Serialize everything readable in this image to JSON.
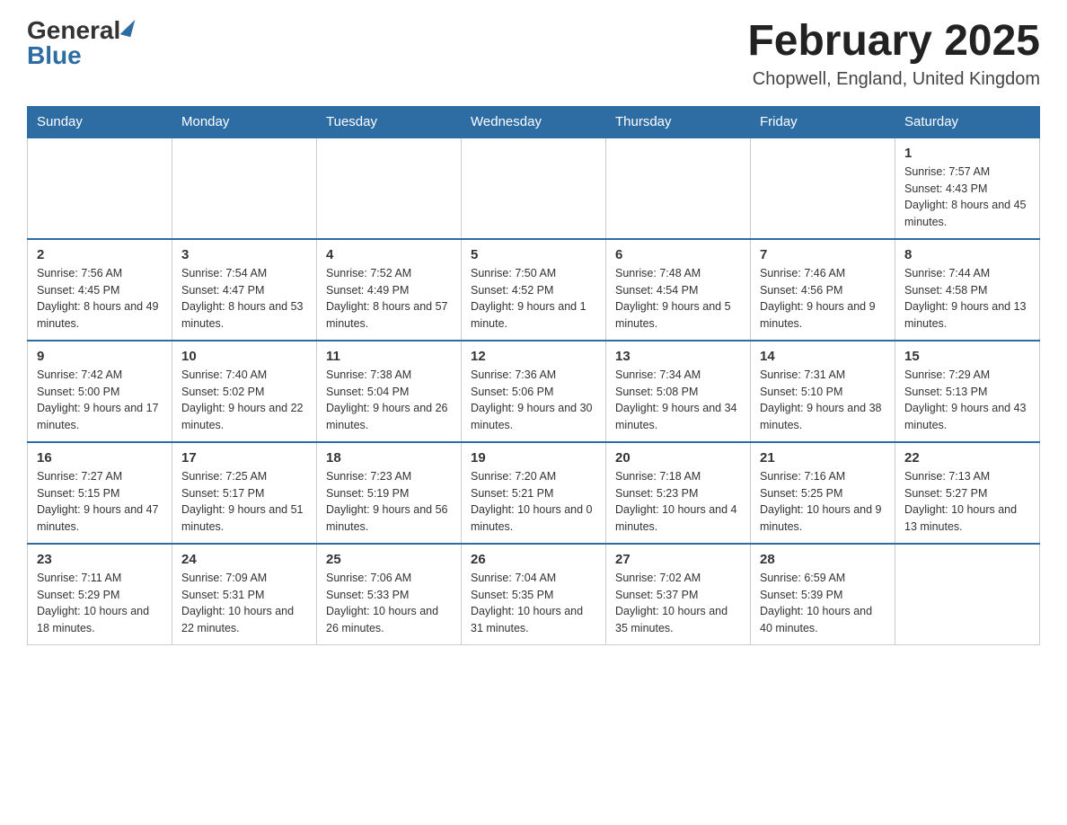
{
  "header": {
    "logo_general": "General",
    "logo_blue": "Blue",
    "month_title": "February 2025",
    "location": "Chopwell, England, United Kingdom"
  },
  "days_of_week": [
    "Sunday",
    "Monday",
    "Tuesday",
    "Wednesday",
    "Thursday",
    "Friday",
    "Saturday"
  ],
  "weeks": [
    [
      {
        "day": "",
        "info": ""
      },
      {
        "day": "",
        "info": ""
      },
      {
        "day": "",
        "info": ""
      },
      {
        "day": "",
        "info": ""
      },
      {
        "day": "",
        "info": ""
      },
      {
        "day": "",
        "info": ""
      },
      {
        "day": "1",
        "info": "Sunrise: 7:57 AM\nSunset: 4:43 PM\nDaylight: 8 hours and 45 minutes."
      }
    ],
    [
      {
        "day": "2",
        "info": "Sunrise: 7:56 AM\nSunset: 4:45 PM\nDaylight: 8 hours and 49 minutes."
      },
      {
        "day": "3",
        "info": "Sunrise: 7:54 AM\nSunset: 4:47 PM\nDaylight: 8 hours and 53 minutes."
      },
      {
        "day": "4",
        "info": "Sunrise: 7:52 AM\nSunset: 4:49 PM\nDaylight: 8 hours and 57 minutes."
      },
      {
        "day": "5",
        "info": "Sunrise: 7:50 AM\nSunset: 4:52 PM\nDaylight: 9 hours and 1 minute."
      },
      {
        "day": "6",
        "info": "Sunrise: 7:48 AM\nSunset: 4:54 PM\nDaylight: 9 hours and 5 minutes."
      },
      {
        "day": "7",
        "info": "Sunrise: 7:46 AM\nSunset: 4:56 PM\nDaylight: 9 hours and 9 minutes."
      },
      {
        "day": "8",
        "info": "Sunrise: 7:44 AM\nSunset: 4:58 PM\nDaylight: 9 hours and 13 minutes."
      }
    ],
    [
      {
        "day": "9",
        "info": "Sunrise: 7:42 AM\nSunset: 5:00 PM\nDaylight: 9 hours and 17 minutes."
      },
      {
        "day": "10",
        "info": "Sunrise: 7:40 AM\nSunset: 5:02 PM\nDaylight: 9 hours and 22 minutes."
      },
      {
        "day": "11",
        "info": "Sunrise: 7:38 AM\nSunset: 5:04 PM\nDaylight: 9 hours and 26 minutes."
      },
      {
        "day": "12",
        "info": "Sunrise: 7:36 AM\nSunset: 5:06 PM\nDaylight: 9 hours and 30 minutes."
      },
      {
        "day": "13",
        "info": "Sunrise: 7:34 AM\nSunset: 5:08 PM\nDaylight: 9 hours and 34 minutes."
      },
      {
        "day": "14",
        "info": "Sunrise: 7:31 AM\nSunset: 5:10 PM\nDaylight: 9 hours and 38 minutes."
      },
      {
        "day": "15",
        "info": "Sunrise: 7:29 AM\nSunset: 5:13 PM\nDaylight: 9 hours and 43 minutes."
      }
    ],
    [
      {
        "day": "16",
        "info": "Sunrise: 7:27 AM\nSunset: 5:15 PM\nDaylight: 9 hours and 47 minutes."
      },
      {
        "day": "17",
        "info": "Sunrise: 7:25 AM\nSunset: 5:17 PM\nDaylight: 9 hours and 51 minutes."
      },
      {
        "day": "18",
        "info": "Sunrise: 7:23 AM\nSunset: 5:19 PM\nDaylight: 9 hours and 56 minutes."
      },
      {
        "day": "19",
        "info": "Sunrise: 7:20 AM\nSunset: 5:21 PM\nDaylight: 10 hours and 0 minutes."
      },
      {
        "day": "20",
        "info": "Sunrise: 7:18 AM\nSunset: 5:23 PM\nDaylight: 10 hours and 4 minutes."
      },
      {
        "day": "21",
        "info": "Sunrise: 7:16 AM\nSunset: 5:25 PM\nDaylight: 10 hours and 9 minutes."
      },
      {
        "day": "22",
        "info": "Sunrise: 7:13 AM\nSunset: 5:27 PM\nDaylight: 10 hours and 13 minutes."
      }
    ],
    [
      {
        "day": "23",
        "info": "Sunrise: 7:11 AM\nSunset: 5:29 PM\nDaylight: 10 hours and 18 minutes."
      },
      {
        "day": "24",
        "info": "Sunrise: 7:09 AM\nSunset: 5:31 PM\nDaylight: 10 hours and 22 minutes."
      },
      {
        "day": "25",
        "info": "Sunrise: 7:06 AM\nSunset: 5:33 PM\nDaylight: 10 hours and 26 minutes."
      },
      {
        "day": "26",
        "info": "Sunrise: 7:04 AM\nSunset: 5:35 PM\nDaylight: 10 hours and 31 minutes."
      },
      {
        "day": "27",
        "info": "Sunrise: 7:02 AM\nSunset: 5:37 PM\nDaylight: 10 hours and 35 minutes."
      },
      {
        "day": "28",
        "info": "Sunrise: 6:59 AM\nSunset: 5:39 PM\nDaylight: 10 hours and 40 minutes."
      },
      {
        "day": "",
        "info": ""
      }
    ]
  ]
}
